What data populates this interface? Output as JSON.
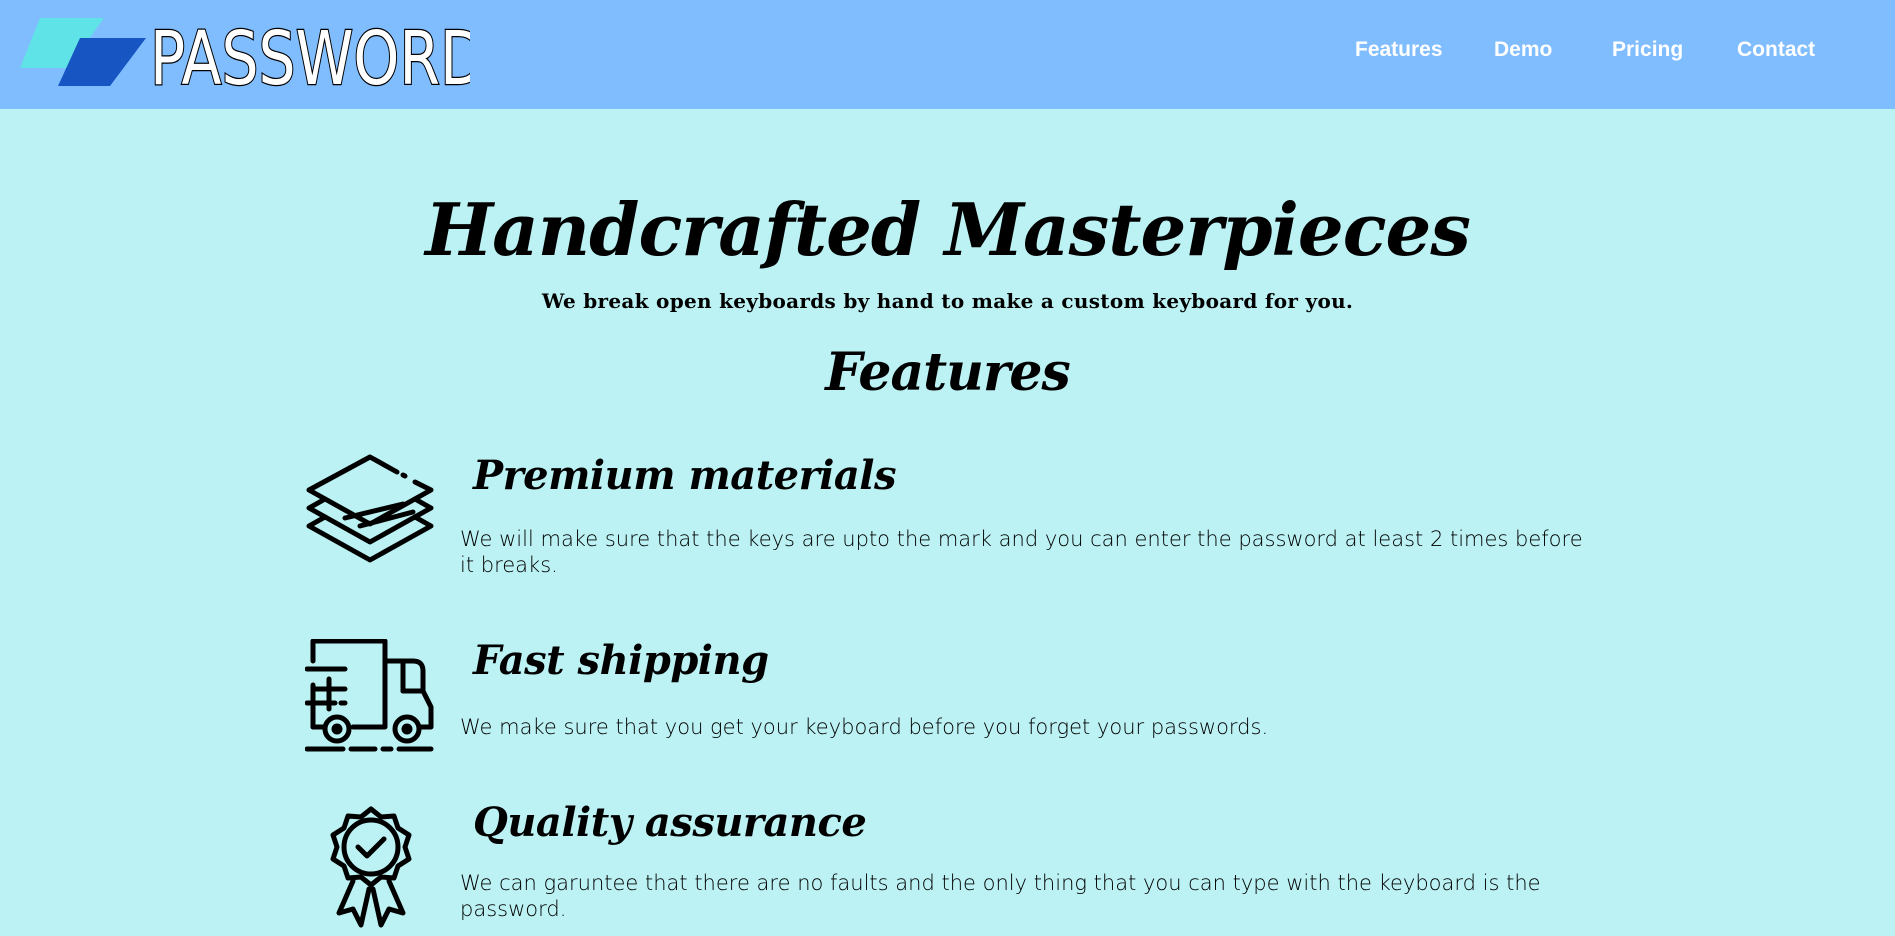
{
  "brand": {
    "name": "PASSWORD",
    "colors": {
      "header_bg": "#80bdff",
      "page_bg": "#bcf2f4",
      "logo_light": "#5fe3e6",
      "logo_dark": "#1756c2"
    }
  },
  "nav": {
    "items": [
      {
        "label": "Features"
      },
      {
        "label": "Demo"
      },
      {
        "label": "Pricing"
      },
      {
        "label": "Contact"
      }
    ]
  },
  "hero": {
    "title": "Handcrafted Masterpieces",
    "subtitle": "We break open keyboards by hand to make a custom keyboard for you."
  },
  "features": {
    "heading": "Features",
    "items": [
      {
        "icon": "layers-icon",
        "title": "Premium materials",
        "description": "We will make sure that the keys are upto the mark and you can enter the password at least 2 times before it breaks."
      },
      {
        "icon": "truck-icon",
        "title": "Fast shipping",
        "description": "We make sure that you get your keyboard before you forget your passwords."
      },
      {
        "icon": "badge-check-icon",
        "title": "Quality assurance",
        "description": "We can garuntee that there are no faults and the only thing that you can type with the keyboard is the password."
      }
    ]
  }
}
